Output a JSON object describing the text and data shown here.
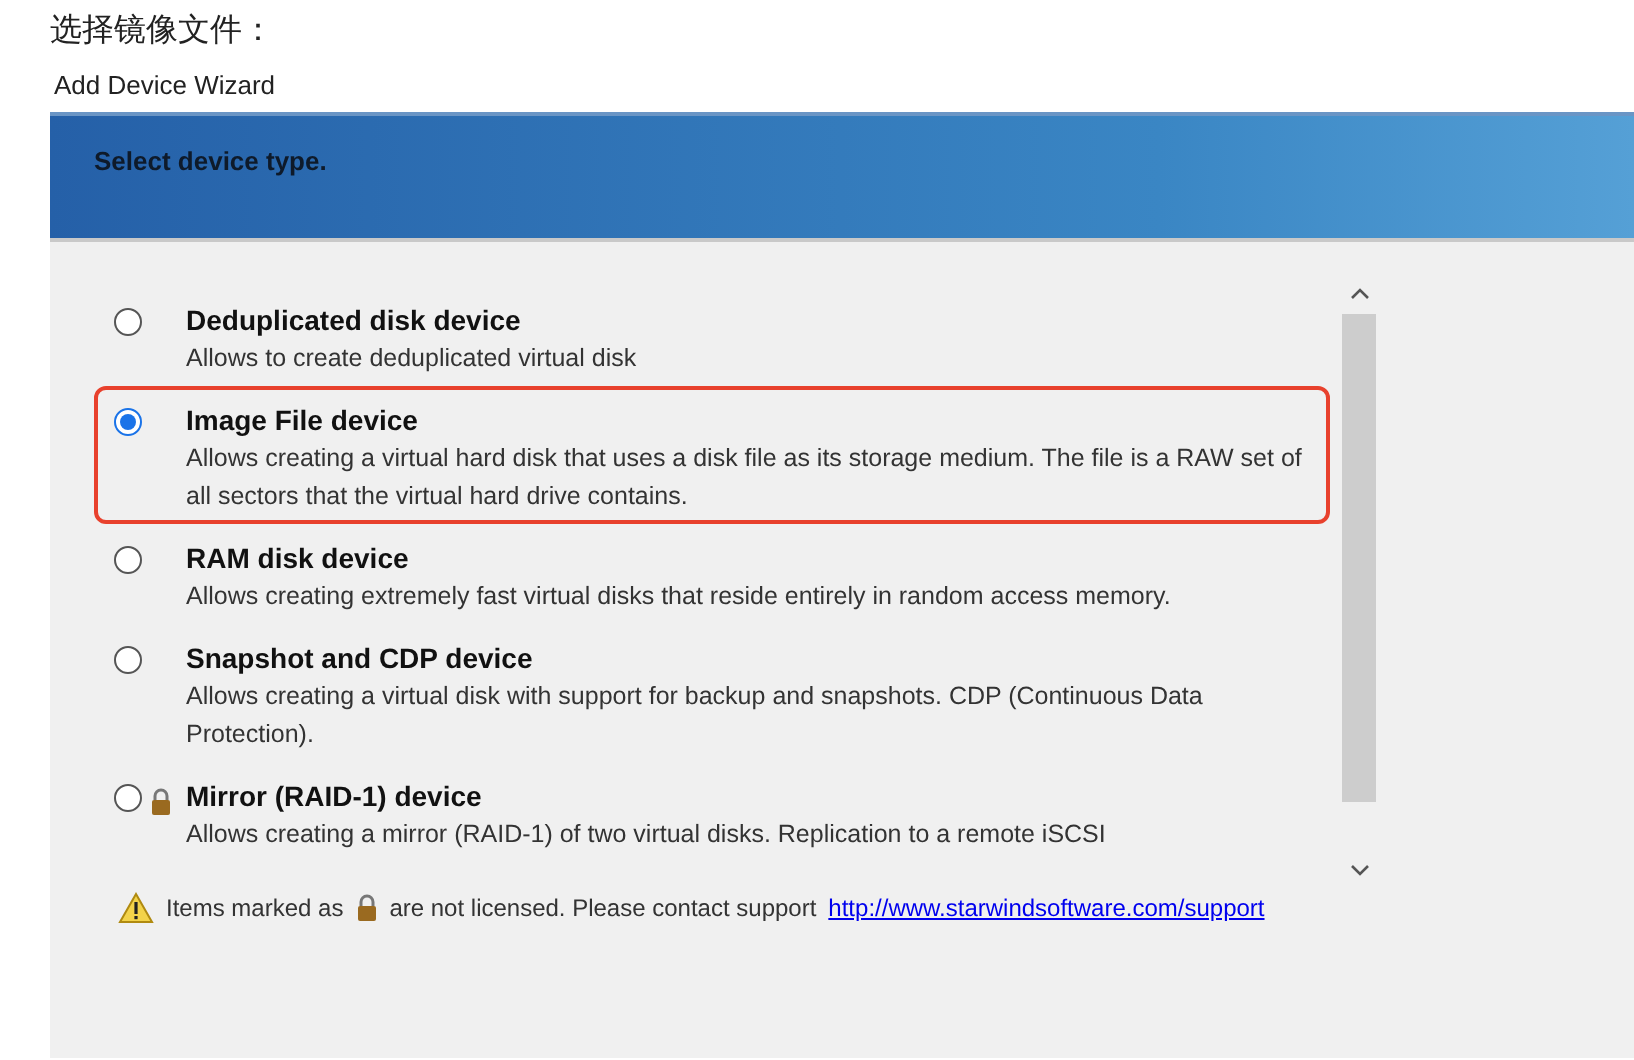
{
  "caption": "选择镜像文件：",
  "window": {
    "title": "Add Device Wizard"
  },
  "header": {
    "title": "Select device type."
  },
  "devices": [
    {
      "title": "Deduplicated disk device",
      "description": "Allows to create deduplicated virtual disk",
      "selected": false,
      "locked": false,
      "highlighted": false
    },
    {
      "title": "Image File device",
      "description": "Allows creating a virtual hard disk that uses a disk file as its storage medium. The file is a RAW set of all sectors that the virtual hard drive contains.",
      "selected": true,
      "locked": false,
      "highlighted": true
    },
    {
      "title": "RAM disk device",
      "description": "Allows creating extremely fast virtual disks that reside entirely in random access memory.",
      "selected": false,
      "locked": false,
      "highlighted": false
    },
    {
      "title": "Snapshot and CDP device",
      "description": "Allows creating a virtual disk with support for backup and snapshots. CDP (Continuous Data Protection).",
      "selected": false,
      "locked": false,
      "highlighted": false
    },
    {
      "title": "Mirror (RAID-1) device",
      "description": "Allows creating a mirror (RAID-1) of two virtual disks. Replication to a remote iSCSI",
      "selected": false,
      "locked": true,
      "highlighted": false
    }
  ],
  "notice": {
    "before": "Items marked as",
    "after": "are not licensed. Please contact support",
    "link": "http://www.starwindsoftware.com/support"
  }
}
